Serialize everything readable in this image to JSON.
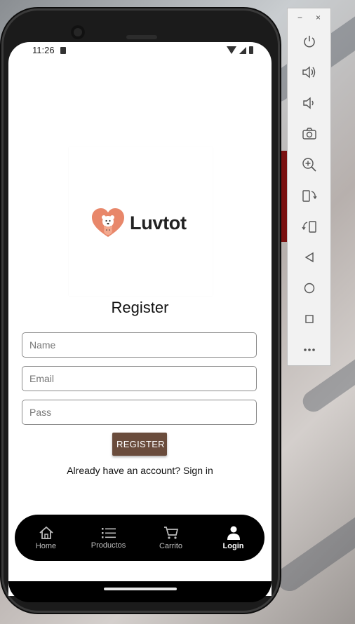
{
  "status_bar": {
    "time": "11:26"
  },
  "brand": {
    "name": "Luvtot",
    "accent": "#e8876a"
  },
  "form": {
    "title": "Register",
    "name_placeholder": "Name",
    "email_placeholder": "Email",
    "pass_placeholder": "Pass",
    "submit_label": "REGISTER",
    "button_color": "#6a4c3c"
  },
  "footer": {
    "prompt": "Already have an account? Sign in"
  },
  "bottom_nav": {
    "items": [
      {
        "label": "Home",
        "icon": "home-icon"
      },
      {
        "label": "Productos",
        "icon": "list-icon"
      },
      {
        "label": "Carrito",
        "icon": "cart-icon"
      },
      {
        "label": "Login",
        "icon": "person-icon",
        "active": true
      }
    ]
  },
  "emulator_panel": {
    "window_controls": [
      "−",
      "×"
    ],
    "tools": [
      "power-icon",
      "volume-up-icon",
      "volume-down-icon",
      "camera-icon",
      "zoom-in-icon",
      "rotate-left-icon",
      "rotate-right-icon",
      "back-icon",
      "home-circle-icon",
      "overview-icon",
      "more-icon"
    ]
  }
}
